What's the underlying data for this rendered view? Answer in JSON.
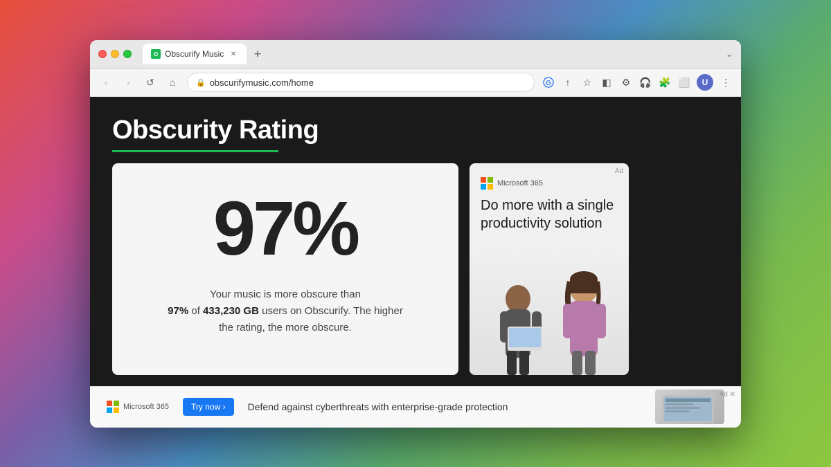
{
  "browser": {
    "tab_label": "Obscurify Music",
    "tab_favicon": "O",
    "url": "obscurifymusic.com/home",
    "new_tab_btn": "+",
    "menu_btn": "⌄"
  },
  "nav": {
    "back": "‹",
    "forward": "›",
    "refresh": "↺",
    "home": "⌂"
  },
  "toolbar": {
    "google_icon": "G",
    "share_icon": "↑",
    "bookmark_icon": "☆",
    "layers_icon": "◧",
    "extensions_icon": "⚙",
    "headphone_icon": "🎧",
    "puzzle_icon": "🧩",
    "split_icon": "⬜",
    "more_icon": "⋮"
  },
  "page": {
    "title": "Obscurity Rating",
    "underline_color": "#1db954"
  },
  "rating_card": {
    "percentage": "97%",
    "description_plain": "Your music is more obscure than",
    "description_bold_1": "97%",
    "description_of": "of",
    "description_bold_2": "433,230 GB",
    "description_rest": "users on Obscurify. The higher the rating, the more obscure."
  },
  "ad_sidebar": {
    "ad_label": "Ad",
    "brand": "Microsoft 365",
    "headline": "Do more with a single productivity solution"
  },
  "bottom_ad": {
    "brand": "Microsoft 365",
    "cta_label": "Try now ›",
    "headline": "Defend against cyberthreats with enterprise-grade protection"
  }
}
